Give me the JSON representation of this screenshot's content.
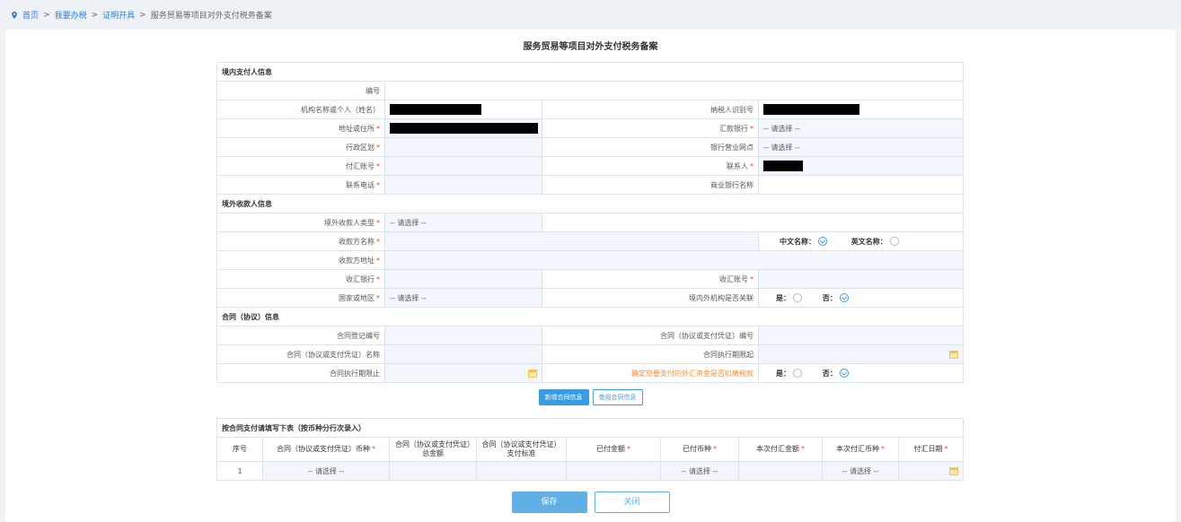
{
  "breadcrumb": {
    "home": "首页",
    "item1": "我要办税",
    "item2": "证明开具",
    "current": "服务贸易等项目对外支付税务备案",
    "sep": ">"
  },
  "page_title": "服务贸易等项目对外支付税务备案",
  "required_mark": "*",
  "sections": {
    "domestic_payer": "境内支付人信息",
    "overseas_payee": "境外收款人信息",
    "contract": "合同（协议）信息",
    "payment": "按合同支付请填写下表（按币种分行次录入）"
  },
  "domestic": {
    "no_label": "编号",
    "org_name_label": "机构名称或个人（姓名）",
    "taxpayer_id_label": "纳税人识别号",
    "address_label": "地址或住所",
    "remit_bank_label": "汇款银行",
    "remit_bank_value": "-- 请选择 --",
    "admin_region_label": "行政区划",
    "bank_branch_label": "银行营业网点",
    "bank_branch_value": "-- 请选择 --",
    "account_label": "付汇账号",
    "contact_label": "联系人",
    "phone_label": "联系电话",
    "commercial_bank_label": "商业银行名称"
  },
  "overseas": {
    "payee_type_label": "境外收款人类型",
    "payee_type_value": "-- 请选择 --",
    "payee_name_label": "收款方名称",
    "cn_name_label": "中文名称：",
    "en_name_label": "英文名称：",
    "payee_address_label": "收款方地址",
    "receive_bank_label": "收汇银行",
    "receive_account_label": "收汇账号",
    "country_label": "国家或地区",
    "country_value": "-- 请选择 --",
    "related_label": "境内外机构是否关联",
    "yes_label": "是：",
    "no_label": "否："
  },
  "contract": {
    "reg_no_label": "合同登记编号",
    "contract_no_label": "合同（协议或支付凭证）编号",
    "name_label": "合同（协议或支付凭证）名称",
    "start_label": "合同执行期限起",
    "end_label": "合同执行期限止",
    "withhold_label": "确定您要支付的外汇资金是否扣缴税款",
    "yes_label": "是：",
    "no_label": "否："
  },
  "buttons": {
    "add_contract": "新增合同信息",
    "query_contract": "查阅合同信息",
    "save": "保存",
    "close": "关闭"
  },
  "payment_table": {
    "columns": [
      "序号",
      "合同（协议或支付凭证）币种",
      "合同（协议或支付凭证）总金额",
      "合同（协议或支付凭证）支付标准",
      "已付金额",
      "已付币种",
      "本次付汇金额",
      "本次付汇币种",
      "付汇日期"
    ],
    "rows": [
      {
        "no": "1",
        "currency": "-- 请选择 --",
        "paid_currency": "-- 请选择 --",
        "this_currency": "-- 请选择 --"
      }
    ]
  }
}
